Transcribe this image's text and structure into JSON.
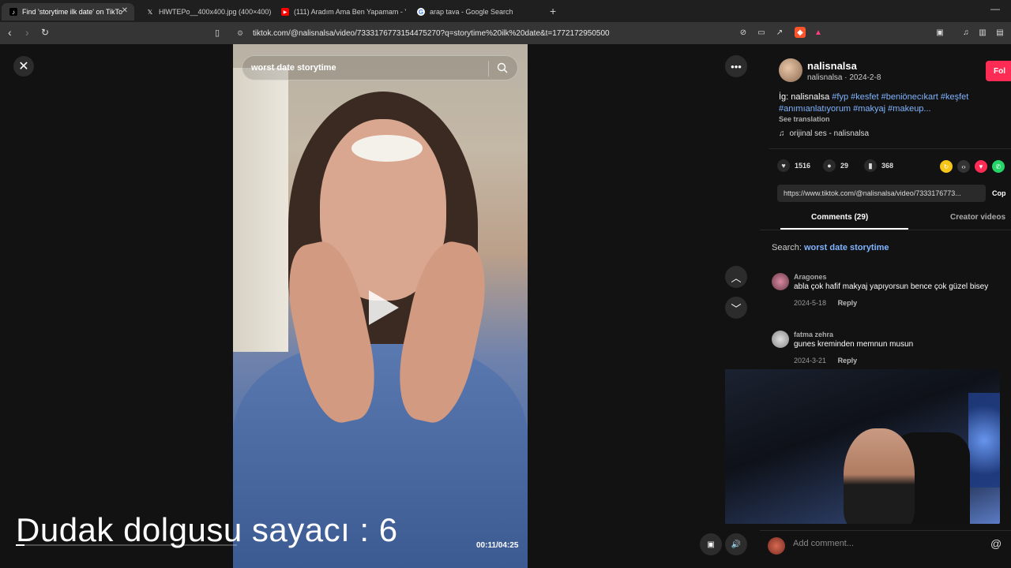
{
  "browser": {
    "tabs": [
      {
        "title": "Find 'storytime ilk date' on TikTo",
        "favicon": "tiktok-icon"
      },
      {
        "title": "HlWTEPo__400x400.jpg (400×400)",
        "favicon": "x-icon"
      },
      {
        "title": "(111) Aradım Ama Ben Yapamam - Y",
        "favicon": "youtube-icon"
      },
      {
        "title": "arap tava - Google Search",
        "favicon": "google-icon"
      }
    ],
    "close_symbol": "✕",
    "new_tab_symbol": "+",
    "minimize_symbol": "—",
    "url": "tiktok.com/@nalisnalsa/video/7333176773154475270?q=storytime%20ilk%20date&t=1772172950500"
  },
  "video": {
    "search_text": "worst date storytime",
    "time": "00:11/04:25",
    "progress": 0.04,
    "overlay_caption": "Dudak dolgusu  sayacı : 6"
  },
  "post": {
    "author_name": "nalisnalsa",
    "author_sub": "nalisnalsa · 2024-2-8",
    "follow_label": "Fol",
    "caption_prefix": "İg: nalisnalsa ",
    "caption_tags": "#fyp #kesfet #beniönecıkart #keşfet #anımıanlatıyorum #makyaj #makeup...",
    "see_translation": "See translation",
    "music": "orijinal ses - nalisnalsa",
    "likes": "1516",
    "comments": "29",
    "saves": "368",
    "link": "https://www.tiktok.com/@nalisnalsa/video/7333176773...",
    "copy_label": "Cop"
  },
  "comments_section": {
    "tab_comments": "Comments (29)",
    "tab_creator": "Creator videos",
    "search_prefix": "Search: ",
    "search_query": "worst date storytime",
    "items": [
      {
        "user": "Aragones",
        "text": "abla çok hafif makyaj yapıyorsun bence çok güzel bisey",
        "date": "2024-5-18",
        "reply": "Reply"
      },
      {
        "user": "fatma zehra",
        "text": "gunes kreminden memnun musun",
        "date": "2024-3-21",
        "reply": "Reply"
      }
    ],
    "add_comment_placeholder": "Add comment...",
    "at_symbol": "@"
  },
  "icons": {
    "more": "•••",
    "up": "︿",
    "down": "﹀",
    "close": "✕",
    "music": "♫",
    "heart": "♥",
    "speech": "●",
    "bookmark": "▮",
    "volume": "🔊",
    "mini": "▣"
  },
  "colors": {
    "accent": "#fe2c55",
    "hashtag": "#80b4ff"
  }
}
